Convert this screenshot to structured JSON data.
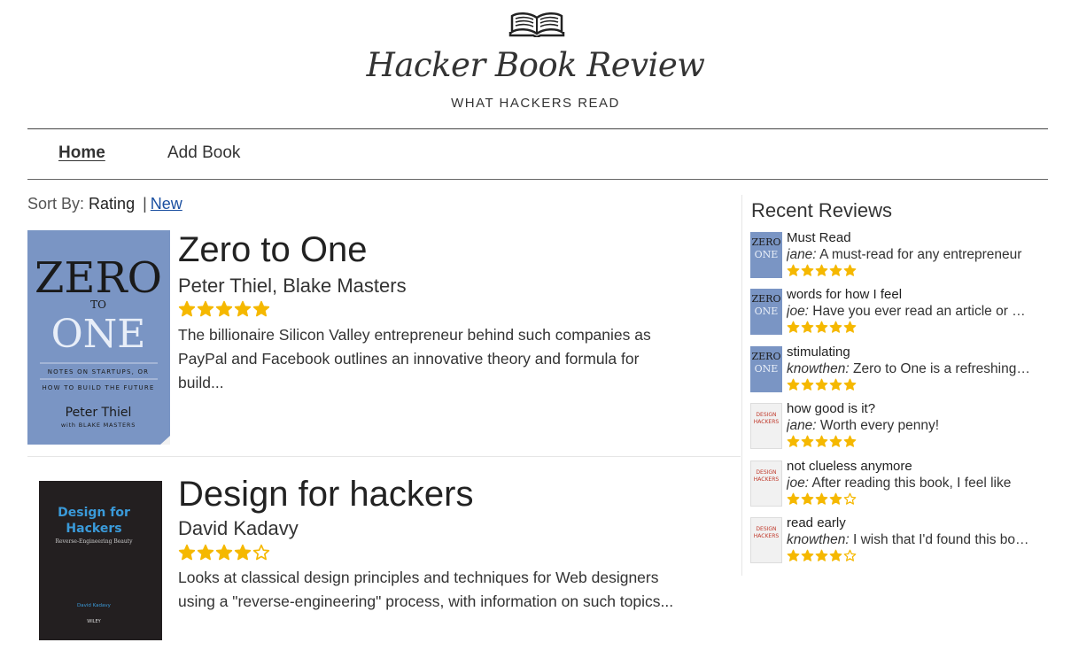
{
  "site": {
    "title": "Hacker Book Review",
    "tagline": "WHAT HACKERS READ"
  },
  "nav": {
    "home": "Home",
    "add_book": "Add Book"
  },
  "sort": {
    "label": "Sort By:",
    "active": "Rating",
    "separator": "|",
    "other": "New"
  },
  "colors": {
    "star": "#f5b800",
    "link": "#1a4fa0",
    "zero_cover": "#7a95c4",
    "design_cover": "#231f20",
    "design_title": "#3a9ad9"
  },
  "books": [
    {
      "title": "Zero to One",
      "author": "Peter Thiel, Blake Masters",
      "rating": 5,
      "description": "The billionaire Silicon Valley entrepreneur behind such companies as PayPal and Facebook outlines an innovative theory and formula for build...",
      "cover": {
        "line1": "ZERO",
        "line2": "TO",
        "line3": "ONE",
        "sub1": "NOTES ON STARTUPS, OR",
        "sub2": "HOW TO BUILD THE FUTURE",
        "author": "Peter Thiel",
        "coauthor": "with BLAKE MASTERS"
      }
    },
    {
      "title": "Design for hackers",
      "author": "David Kadavy",
      "rating": 4,
      "description": "Looks at classical design principles and techniques for Web designers using a \"reverse-engineering\" process, with information on such topics...",
      "cover": {
        "line1": "Design for",
        "line2": "Hackers",
        "sub": "Reverse-Engineering Beauty",
        "author": "David Kadavy",
        "publisher": "WILEY"
      }
    }
  ],
  "sidebar": {
    "title": "Recent Reviews",
    "reviews": [
      {
        "title": "Must Read",
        "user": "jane:",
        "text": " A must-read for any entrepreneur",
        "rating": 5,
        "cover": "zero"
      },
      {
        "title": "words for how I feel",
        "user": "joe:",
        "text": " Have you ever read an article or book",
        "rating": 5,
        "cover": "zero"
      },
      {
        "title": "stimulating",
        "user": "knowthen:",
        "text": " Zero to One is a refreshing read",
        "rating": 5,
        "cover": "zero"
      },
      {
        "title": "how good is it?",
        "user": "jane:",
        "text": " Worth every penny!",
        "rating": 5,
        "cover": "design"
      },
      {
        "title": "not clueless anymore",
        "user": "joe:",
        "text": " After reading this book, I feel like",
        "rating": 4,
        "cover": "design"
      },
      {
        "title": "read early",
        "user": "knowthen:",
        "text": " I wish that I'd found this book sooner",
        "rating": 4,
        "cover": "design"
      }
    ],
    "thumb_text": {
      "zero_1": "ZERO",
      "zero_2": "ONE",
      "design_1": "DESIGN",
      "design_2": "HACKERS"
    }
  }
}
